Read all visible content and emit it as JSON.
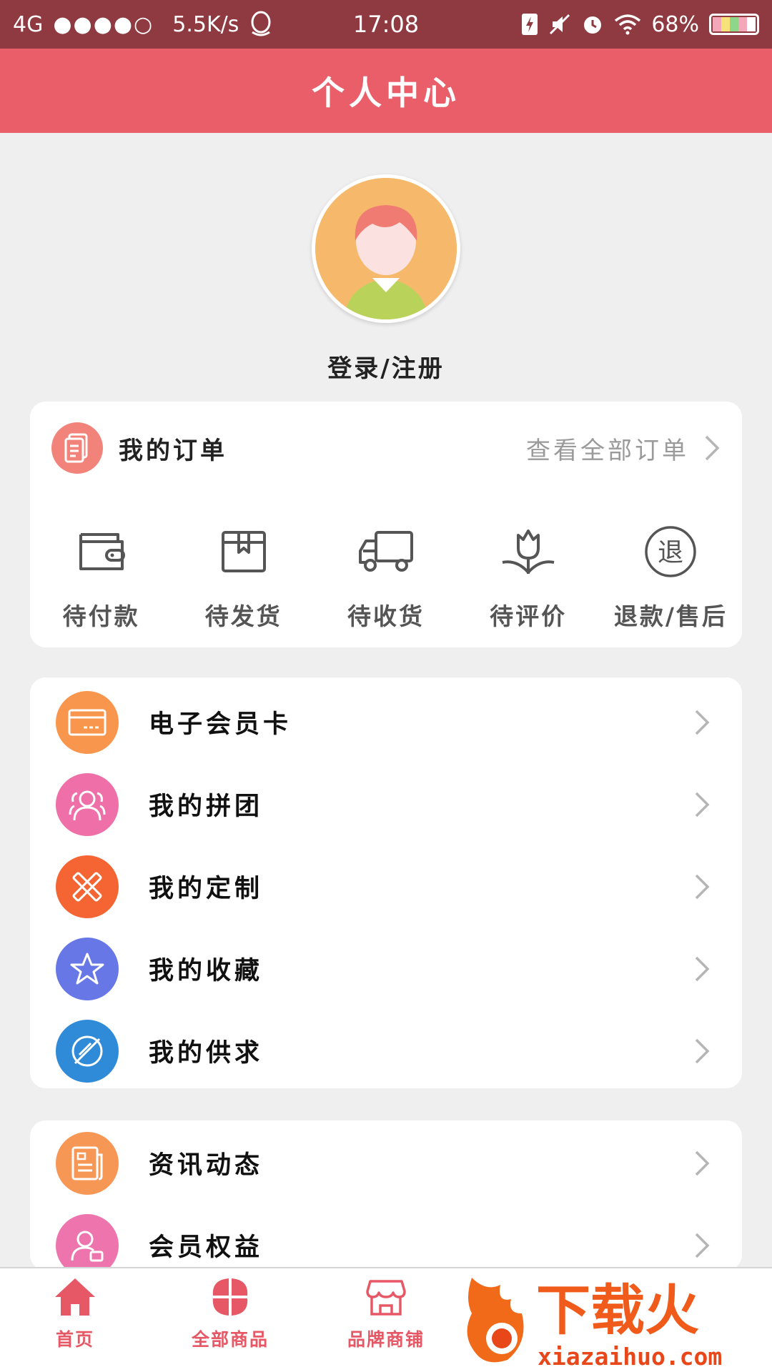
{
  "status_bar": {
    "network": "4G",
    "speed": "5.5K/s",
    "time": "17:08",
    "battery": "68%"
  },
  "header": {
    "title": "个人中心"
  },
  "profile": {
    "login_label": "登录/注册"
  },
  "orders": {
    "title": "我的订单",
    "view_all": "查看全部订单",
    "statuses": [
      {
        "label": "待付款",
        "icon": "wallet-icon"
      },
      {
        "label": "待发货",
        "icon": "package-icon"
      },
      {
        "label": "待收货",
        "icon": "truck-icon"
      },
      {
        "label": "待评价",
        "icon": "flower-icon"
      },
      {
        "label": "退款/售后",
        "icon": "refund-icon",
        "icon_glyph": "退"
      }
    ]
  },
  "menu_group_1": [
    {
      "label": "电子会员卡",
      "icon": "card-icon",
      "color": "#f9964d"
    },
    {
      "label": "我的拼团",
      "icon": "group-icon",
      "color": "#ef6fa8"
    },
    {
      "label": "我的定制",
      "icon": "tools-icon",
      "color": "#f46533"
    },
    {
      "label": "我的收藏",
      "icon": "star-icon",
      "color": "#6778e6"
    },
    {
      "label": "我的供求",
      "icon": "supply-icon",
      "color": "#2f8ad8"
    }
  ],
  "menu_group_2": [
    {
      "label": "资讯动态",
      "icon": "news-icon",
      "color": "#f79755"
    },
    {
      "label": "会员权益",
      "icon": "member-icon",
      "color": "#ee74ad"
    }
  ],
  "bottom_nav": [
    {
      "label": "首页",
      "icon": "home-icon"
    },
    {
      "label": "全部商品",
      "icon": "grid-icon"
    },
    {
      "label": "品牌商铺",
      "icon": "shop-icon"
    }
  ],
  "watermark": {
    "text": "下载火",
    "url": "xiazaihuo.com"
  },
  "colors": {
    "status_bar": "#8f3a40",
    "header": "#e95e69",
    "background": "#efefef",
    "accent": "#e65865"
  }
}
